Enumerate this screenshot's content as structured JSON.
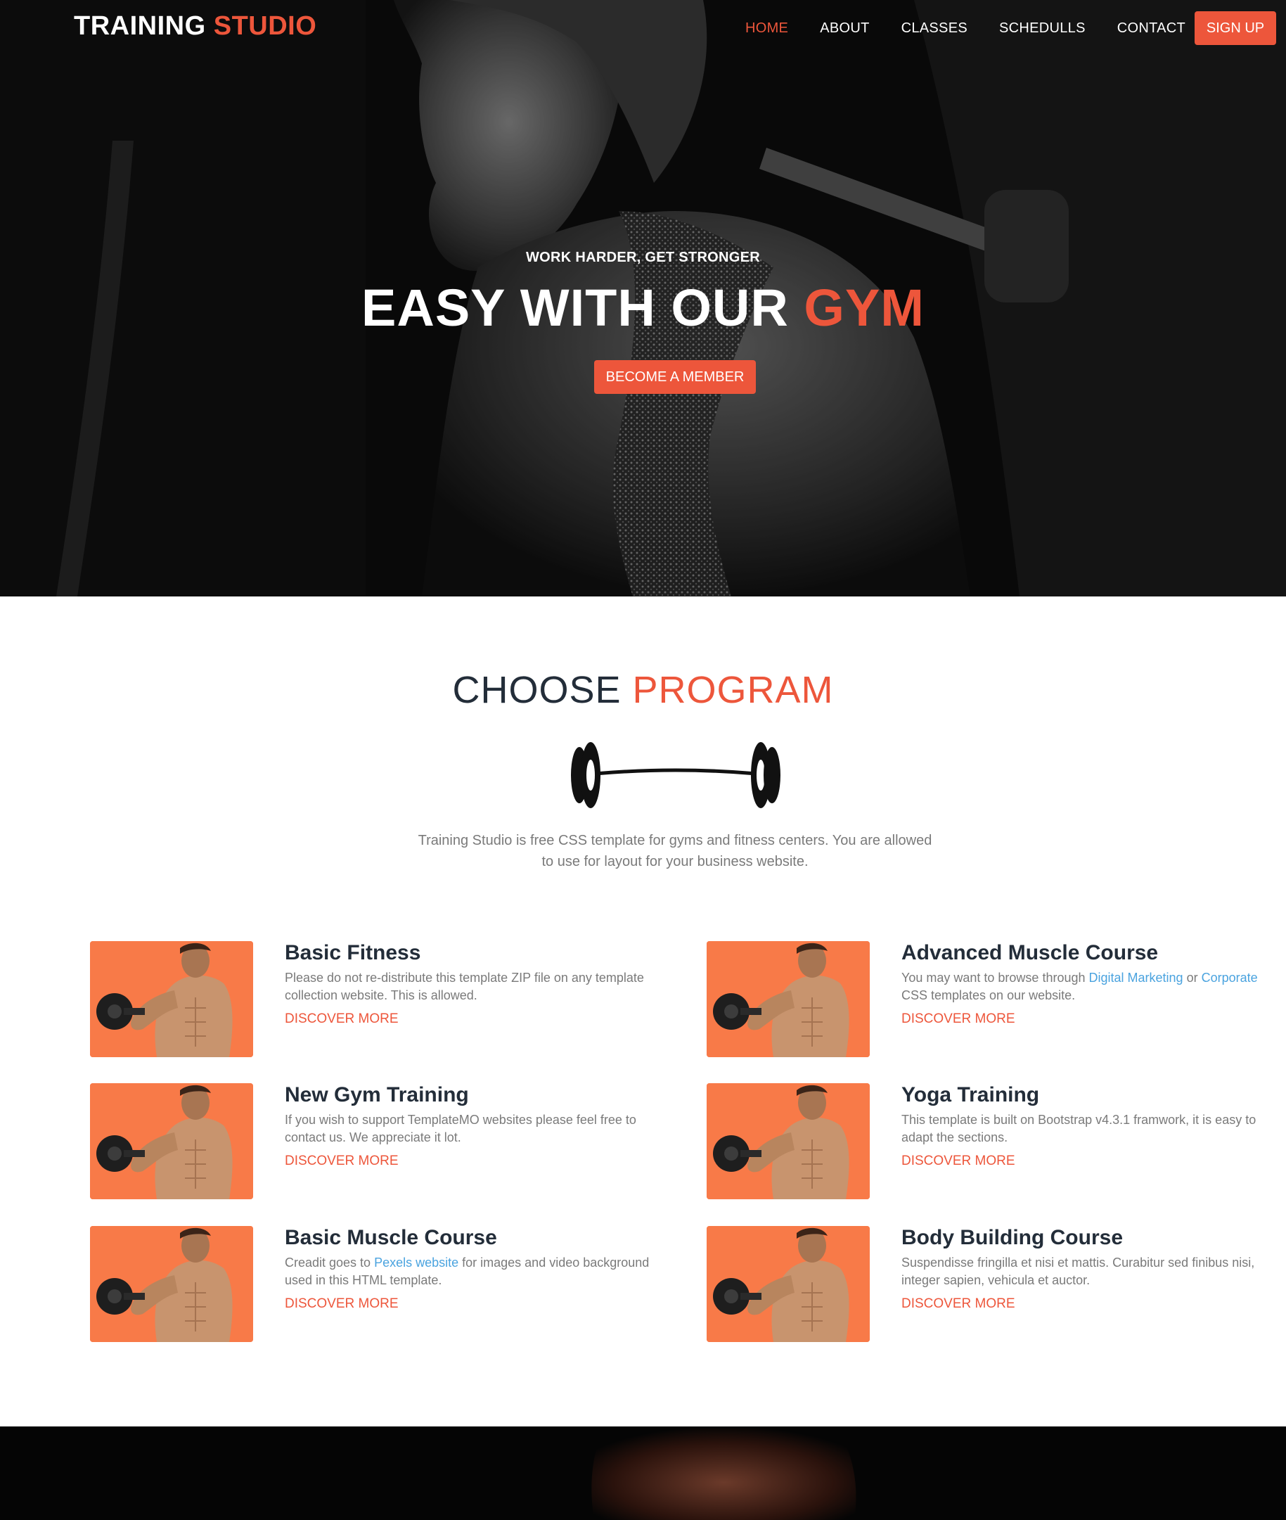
{
  "colors": {
    "accent": "#ed563b",
    "dark": "#232d39",
    "link": "#4aa3df",
    "thumb_bg": "#f87a48"
  },
  "header": {
    "logo_main": "TRAINING",
    "logo_accent": "STUDIO",
    "nav": [
      {
        "label": "HOME",
        "active": true
      },
      {
        "label": "ABOUT",
        "active": false
      },
      {
        "label": "CLASSES",
        "active": false
      },
      {
        "label": "SCHEDULLS",
        "active": false
      },
      {
        "label": "CONTACT",
        "active": false
      }
    ],
    "signup_label": "SIGN UP"
  },
  "hero": {
    "subtitle": "WORK HARDER, GET STRONGER",
    "title_main": "EASY WITH OUR",
    "title_accent": "GYM",
    "button_label": "BECOME A MEMBER"
  },
  "programs_section": {
    "title_main": "CHOOSE",
    "title_accent": "PROGRAM",
    "icon": "barbell-icon",
    "description": "Training Studio is free CSS template for gyms and fitness centers. You are allowed to use for layout for your business website."
  },
  "programs": [
    {
      "title": "Basic Fitness",
      "text_before": "Please do not re-distribute this template ZIP file on any template collection website. This is allowed.",
      "link1": "",
      "text_mid": "",
      "link2": "",
      "text_after": "",
      "more": "DISCOVER MORE"
    },
    {
      "title": "Advanced Muscle Course",
      "text_before": "You may want to browse through ",
      "link1": "Digital Marketing",
      "text_mid": " or ",
      "link2": "Corporate",
      "text_after": " CSS templates on our website.",
      "more": "DISCOVER MORE"
    },
    {
      "title": "New Gym Training",
      "text_before": "If you wish to support TemplateMO websites please feel free to contact us. We appreciate it lot.",
      "link1": "",
      "text_mid": "",
      "link2": "",
      "text_after": "",
      "more": "DISCOVER MORE"
    },
    {
      "title": "Yoga Training",
      "text_before": "This template is built on Bootstrap v4.3.1 framwork, it is easy to adapt the sections.",
      "link1": "",
      "text_mid": "",
      "link2": "",
      "text_after": "",
      "more": "DISCOVER MORE"
    },
    {
      "title": "Basic Muscle Course",
      "text_before": "Creadit goes to ",
      "link1": "Pexels website",
      "text_mid": " for images and video background used in this HTML template.",
      "link2": "",
      "text_after": "",
      "more": "DISCOVER MORE"
    },
    {
      "title": "Body Building Course",
      "text_before": "Suspendisse fringilla et nisi et mattis. Curabitur sed finibus nisi, integer sapien, vehicula et auctor.",
      "link1": "",
      "text_mid": "",
      "link2": "",
      "text_after": "",
      "more": "DISCOVER MORE"
    }
  ]
}
